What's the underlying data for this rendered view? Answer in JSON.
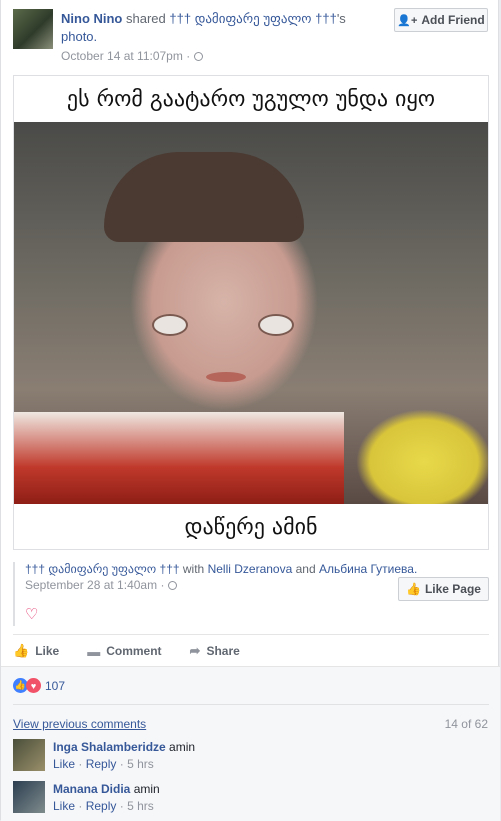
{
  "post": {
    "author": "Nino Nino",
    "shared_word": "shared",
    "page_name": "††† დამიფარე უფალო †††",
    "possessive": "'s",
    "object": "photo.",
    "date": "October 14 at 11:07pm",
    "dot": "·",
    "add_friend_label": "Add Friend"
  },
  "photo": {
    "top_text": "ეს რომ გაატარო უგულო უნდა იყო",
    "bottom_text": "დაწერე ამინ"
  },
  "shared_meta": {
    "page_name": "††† დამიფარე უფალო †††",
    "with": "with",
    "friend1": "Nelli Dzeranova",
    "and": "and",
    "friend2": "Альбина Гутиева.",
    "date": "September 28 at 1:40am",
    "dot": "·",
    "like_page_label": "Like Page"
  },
  "actions": {
    "like": "Like",
    "comment": "Comment",
    "share": "Share"
  },
  "reactions": {
    "count": "107"
  },
  "comments": {
    "view_previous": "View previous comments",
    "count": "14 of 62",
    "items": [
      {
        "name": "Inga Shalamberidze",
        "text": "amin",
        "like": "Like",
        "reply": "Reply",
        "dot": "·",
        "time": "5 hrs"
      },
      {
        "name": "Manana Didia",
        "text": "amin",
        "like": "Like",
        "reply": "Reply",
        "dot": "·",
        "time": "5 hrs"
      }
    ]
  }
}
